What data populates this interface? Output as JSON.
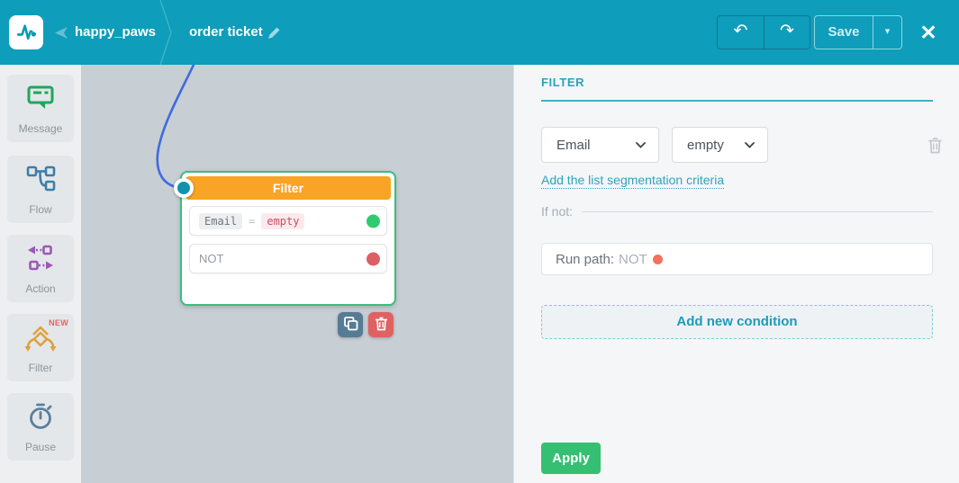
{
  "header": {
    "project": "happy_paws",
    "flow_name": "order ticket",
    "save_label": "Save",
    "undo_glyph": "↶",
    "redo_glyph": "↷",
    "caret_glyph": "▾",
    "close_glyph": "✕",
    "icons": [
      "pulse-logo-icon",
      "back-arrow-icon",
      "edit-pencil-icon"
    ]
  },
  "sidebar": {
    "items": [
      {
        "label": "Message",
        "icon": "message-bubble-icon",
        "color": "#1ea75b"
      },
      {
        "label": "Flow",
        "icon": "flow-branch-icon",
        "color": "#3d7ea8"
      },
      {
        "label": "Action",
        "icon": "action-arrows-icon",
        "color": "#9a59b5"
      },
      {
        "label": "Filter",
        "icon": "filter-diamond-icon",
        "color": "#dfa23c",
        "badge": "NEW"
      },
      {
        "label": "Pause",
        "icon": "stopwatch-icon",
        "color": "#5b7f9d"
      }
    ]
  },
  "node": {
    "title": "Filter",
    "condition": {
      "field": "Email",
      "operator": "=",
      "value": "empty"
    },
    "else_label": "NOT",
    "actions": {
      "copy_icon": "copy-icon",
      "delete_icon": "trash-icon"
    }
  },
  "panel": {
    "title": "FILTER",
    "field_select": {
      "value": "Email"
    },
    "operator_select": {
      "value": "empty"
    },
    "segmentation_link": "Add the list segmentation criteria",
    "if_not_label": "If not:",
    "run_path": {
      "prefix": "Run path:",
      "value": "NOT"
    },
    "add_condition_label": "Add new condition",
    "apply_label": "Apply"
  },
  "colors": {
    "topbar_teal": "#0e9dba",
    "panel_accent_teal": "#29a3bd",
    "node_header_orange": "#f9a424",
    "node_border_green": "#3cbd7c",
    "connector_blue": "#3f6be0",
    "input_port_teal": "#1193ae",
    "success_dot_green": "#2ecb70",
    "fail_dot_red": "#dc5f66",
    "copy_btn_slate": "#567b94",
    "delete_btn_red": "#df6262",
    "apply_green": "#35bf73",
    "run_path_dot": "#f4705c"
  }
}
